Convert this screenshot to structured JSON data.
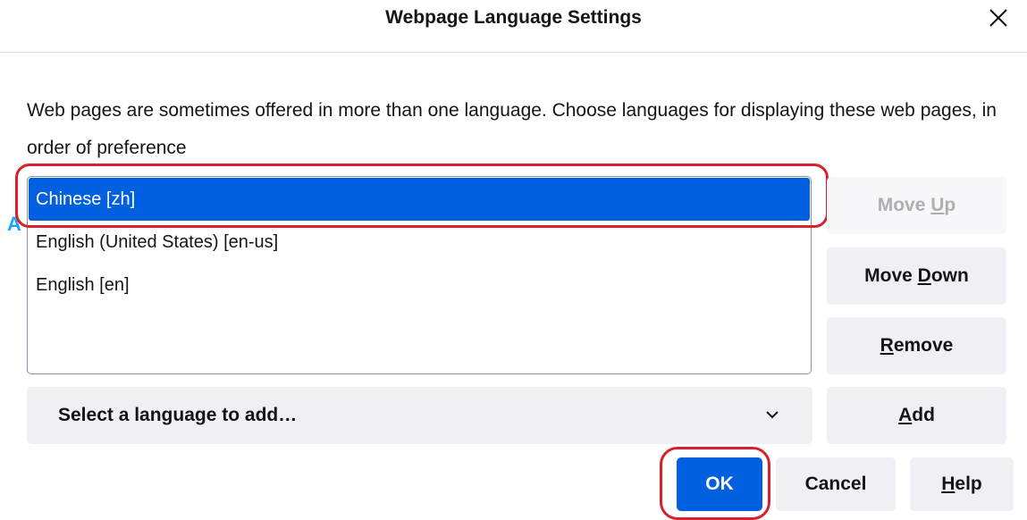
{
  "dialog": {
    "title": "Webpage Language Settings",
    "description": "Web pages are sometimes offered in more than one language. Choose languages for displaying these web pages, in order of preference"
  },
  "languages": [
    {
      "label": "Chinese [zh]",
      "selected": true
    },
    {
      "label": "English (United States) [en-us]",
      "selected": false
    },
    {
      "label": "English [en]",
      "selected": false
    }
  ],
  "side_buttons": {
    "move_up": {
      "pre": "Move ",
      "key": "U",
      "post": "p",
      "disabled": true
    },
    "move_down": {
      "pre": "Move ",
      "key": "D",
      "post": "own",
      "disabled": false
    },
    "remove": {
      "pre": "",
      "key": "R",
      "post": "emove",
      "disabled": false
    },
    "add": {
      "pre": "",
      "key": "A",
      "post": "dd",
      "disabled": false
    }
  },
  "select_language": {
    "value": "Select a language to add…"
  },
  "footer": {
    "ok": "OK",
    "cancel": "Cancel",
    "help_key": "H",
    "help_rest": "elp"
  },
  "marker": "A",
  "colors": {
    "accent": "#0060df",
    "highlight": "#d9202a"
  },
  "icons": [
    "close-icon",
    "chevron-down-icon"
  ]
}
